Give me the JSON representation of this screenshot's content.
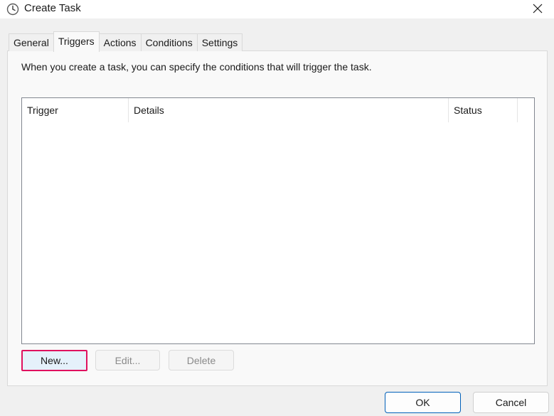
{
  "window": {
    "title": "Create Task",
    "icon": "clock-icon",
    "close_icon": "close-icon"
  },
  "tabs": [
    {
      "label": "General",
      "active": false
    },
    {
      "label": "Triggers",
      "active": true
    },
    {
      "label": "Actions",
      "active": false
    },
    {
      "label": "Conditions",
      "active": false
    },
    {
      "label": "Settings",
      "active": false
    }
  ],
  "triggers_panel": {
    "description": "When you create a task, you can specify the conditions that will trigger the task.",
    "columns": [
      "Trigger",
      "Details",
      "Status"
    ],
    "rows": []
  },
  "buttons": {
    "new": "New...",
    "edit": "Edit...",
    "delete": "Delete",
    "ok": "OK",
    "cancel": "Cancel"
  },
  "colors": {
    "highlight_border": "#e0115f",
    "default_button_border": "#005fb8",
    "new_button_fill": "#e5f1fb"
  }
}
